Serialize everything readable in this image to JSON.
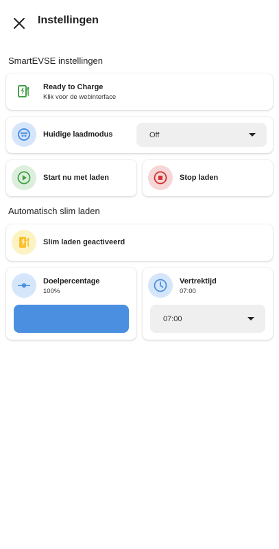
{
  "header": {
    "title": "Instellingen"
  },
  "sections": {
    "smartevse": "SmartEVSE instellingen",
    "auto": "Automatisch slim laden"
  },
  "status_card": {
    "title": "Ready to Charge",
    "subtitle": "Klik voor de webinterface"
  },
  "mode_card": {
    "label": "Huidige laadmodus",
    "selected": "Off"
  },
  "start_card": {
    "label": "Start nu met laden"
  },
  "stop_card": {
    "label": "Stop laden"
  },
  "smart_card": {
    "label": "Slim laden geactiveerd"
  },
  "target_card": {
    "label": "Doelpercentage",
    "value": "100%",
    "level_percent": 100
  },
  "departure_card": {
    "label": "Vertrektijd",
    "value": "07:00",
    "selected": "07:00"
  },
  "colors": {
    "green": "#43a047",
    "blue": "#4a8fe0",
    "red": "#d32f2f",
    "yellow": "#fbc02d"
  }
}
